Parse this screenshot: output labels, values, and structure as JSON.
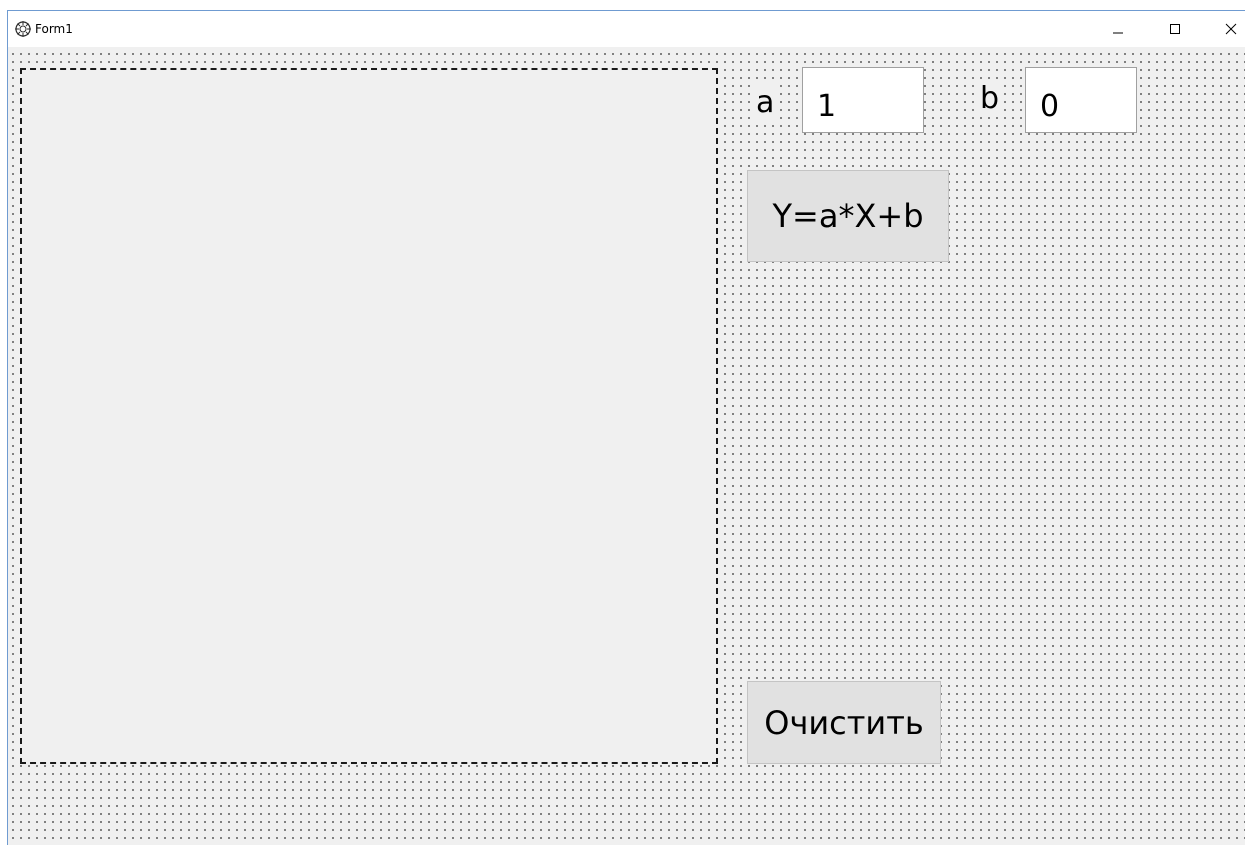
{
  "window": {
    "title": "Form1",
    "icon": "delphi-form-icon",
    "controls": {
      "minimize_icon": "minimize-icon",
      "maximize_icon": "maximize-icon",
      "close_icon": "close-icon"
    }
  },
  "form": {
    "label_a": "a",
    "input_a_value": "1",
    "label_b": "b",
    "input_b_value": "0",
    "plot_button_label": "Y=a*X+b",
    "clear_button_label": "Очистить"
  },
  "colors": {
    "client_background": "#f0f0f0",
    "grid_dots": "#5a5a5a",
    "button_face": "#e1e1e1",
    "window_border": "#6f9bd1"
  }
}
